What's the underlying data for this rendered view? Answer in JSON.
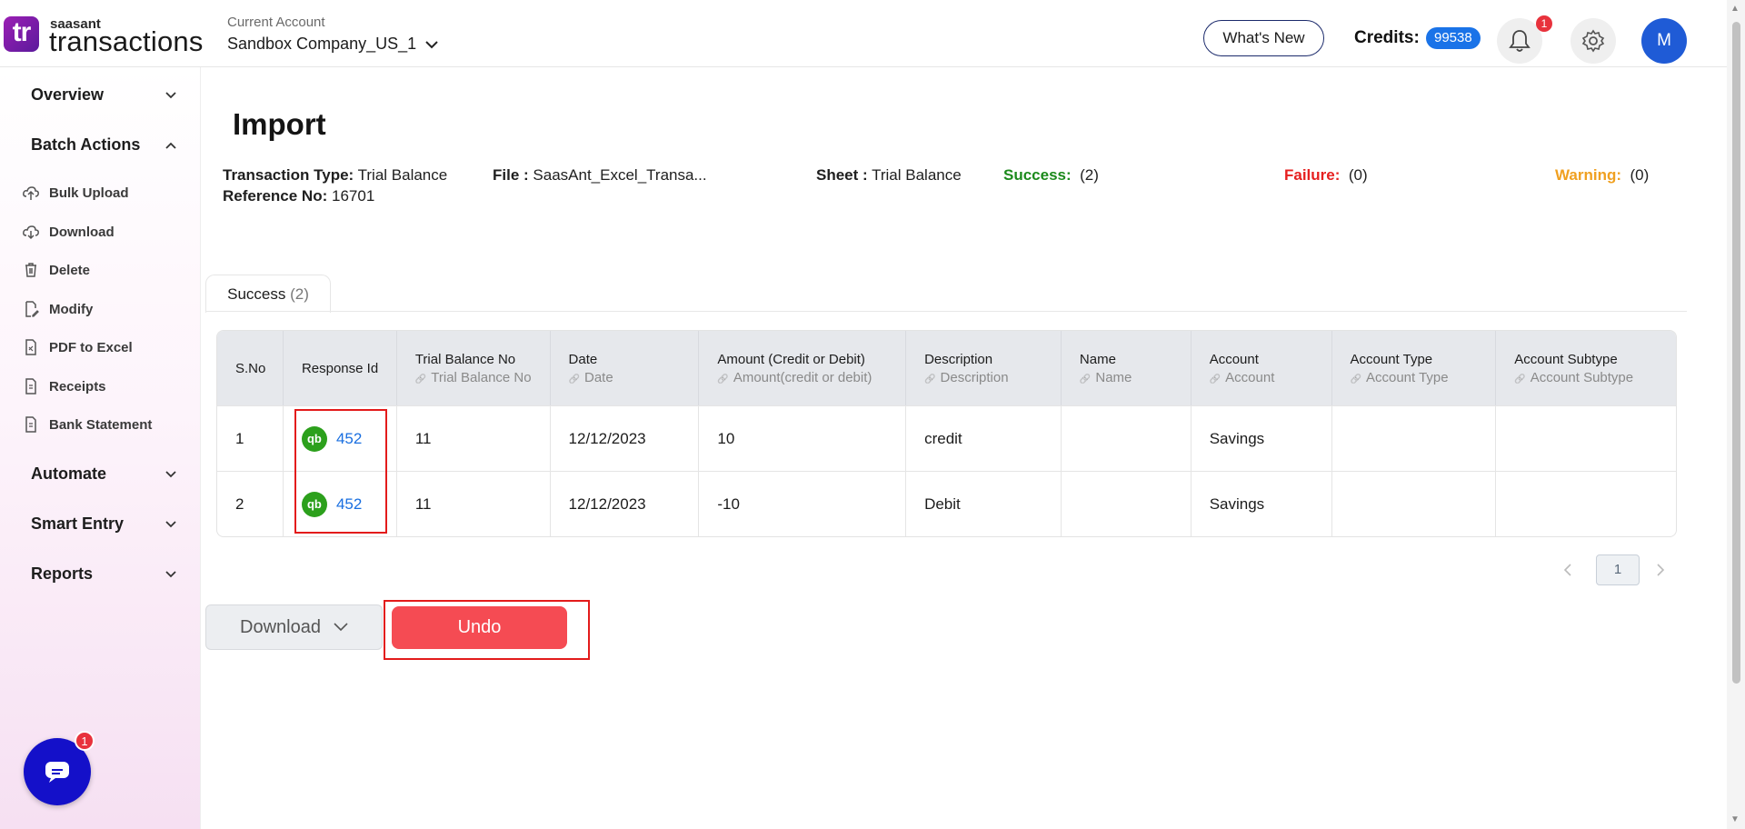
{
  "header": {
    "logo_text": "tr",
    "brand_top": "saasant",
    "brand_main": "transactions",
    "account_label": "Current Account",
    "account_name": "Sandbox Company_US_1",
    "whats_new": "What's New",
    "credits_label": "Credits:",
    "credits_value": "99538",
    "notification_count": "1",
    "avatar_initial": "M"
  },
  "sidebar": {
    "groups": {
      "overview": "Overview",
      "batch_actions": "Batch Actions",
      "automate": "Automate",
      "smart_entry": "Smart Entry",
      "reports": "Reports"
    },
    "batch_items": [
      "Bulk Upload",
      "Download",
      "Delete",
      "Modify",
      "PDF to Excel",
      "Receipts",
      "Bank Statement"
    ],
    "chat_badge": "1"
  },
  "page": {
    "title": "Import",
    "transaction_type_label": "Transaction Type:",
    "transaction_type": "Trial Balance",
    "reference_label": "Reference No:",
    "reference_no": "16701",
    "file_label": "File :",
    "file_name": "SaasAnt_Excel_Transa...",
    "sheet_label": "Sheet :",
    "sheet_name": "Trial Balance",
    "success_label": "Success:",
    "success_count": "(2)",
    "failure_label": "Failure:",
    "failure_count": "(0)",
    "warning_label": "Warning:",
    "warning_count": "(0)",
    "colors": {
      "success": "#1c8a1c",
      "failure": "#e62020",
      "warning": "#f0a020",
      "undo": "#f54b53"
    }
  },
  "tabs": [
    {
      "label": "Success",
      "count": "(2)"
    }
  ],
  "table": {
    "headers": [
      {
        "title": "S.No",
        "sub": ""
      },
      {
        "title": "Response Id",
        "sub": ""
      },
      {
        "title": "Trial Balance No",
        "sub": "Trial Balance No"
      },
      {
        "title": "Date",
        "sub": "Date"
      },
      {
        "title": "Amount (Credit or Debit)",
        "sub": "Amount(credit or debit)"
      },
      {
        "title": "Description",
        "sub": "Description"
      },
      {
        "title": "Name",
        "sub": "Name"
      },
      {
        "title": "Account",
        "sub": "Account"
      },
      {
        "title": "Account Type",
        "sub": "Account Type"
      },
      {
        "title": "Account Subtype",
        "sub": "Account Subtype"
      }
    ],
    "rows": [
      {
        "sno": "1",
        "response_icon": "qb",
        "response_id": "452",
        "tb_no": "11",
        "date": "12/12/2023",
        "amount": "10",
        "description": "credit",
        "name": "",
        "account": "Savings",
        "account_type": "",
        "account_subtype": ""
      },
      {
        "sno": "2",
        "response_icon": "qb",
        "response_id": "452",
        "tb_no": "11",
        "date": "12/12/2023",
        "amount": "-10",
        "description": "Debit",
        "name": "",
        "account": "Savings",
        "account_type": "",
        "account_subtype": ""
      }
    ]
  },
  "pagination": {
    "current_page": "1"
  },
  "actions": {
    "download": "Download",
    "undo": "Undo"
  }
}
